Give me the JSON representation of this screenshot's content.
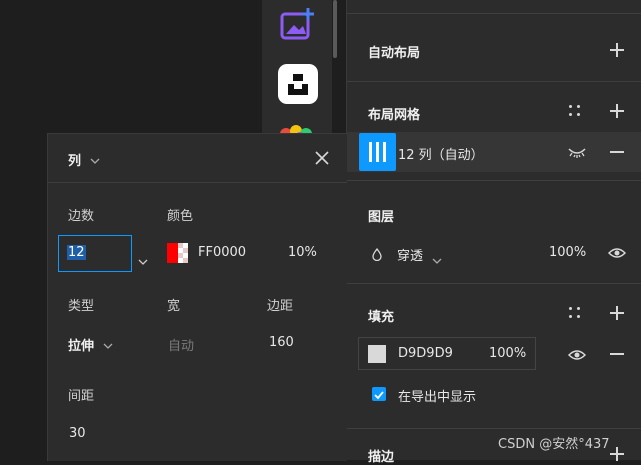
{
  "right_panel": {
    "auto_layout": {
      "title": "自动布局"
    },
    "layout_grid": {
      "title": "布局网格",
      "grid_item_label": "12 列（自动）"
    },
    "layers": {
      "title": "图层",
      "blend_mode": "穿透",
      "opacity": "100%"
    },
    "fill": {
      "title": "填充",
      "color_hex": "D9D9D9",
      "opacity": "100%",
      "swatch_color": "#d9d9d9",
      "export_label": "在导出中显示"
    },
    "stroke": {
      "title": "描边"
    }
  },
  "popup": {
    "type_select": "列",
    "count_label": "边数",
    "count_value": "12",
    "color_label": "颜色",
    "color_hex": "FF0000",
    "color_opacity": "10%",
    "type_label": "类型",
    "width_label": "宽",
    "margin_label": "边距",
    "type_value": "拉伸",
    "width_value": "自动",
    "margin_value": "160",
    "gutter_label": "间距",
    "gutter_value": "30"
  },
  "watermark": "CSDN @安然°437",
  "colors": {
    "accent": "#0d99ff",
    "panel_bg": "#2c2c2c",
    "canvas_bg": "#1e1e1e",
    "grid_color": "#ff0000"
  }
}
